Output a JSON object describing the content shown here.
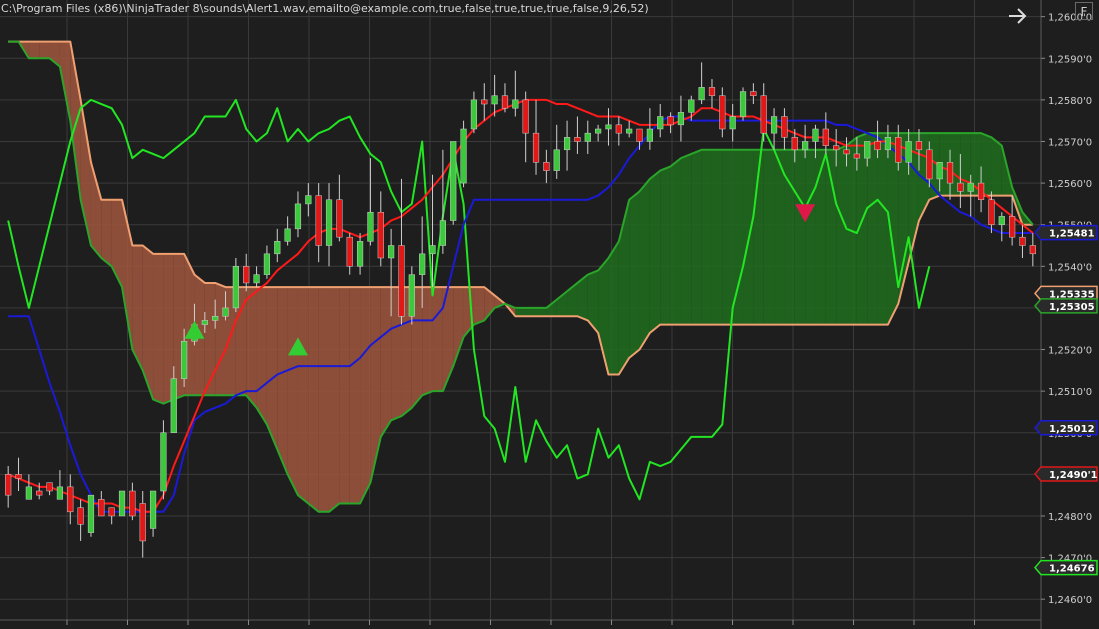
{
  "header": {
    "indicator_settings": "C:\\Program Files (x86)\\NinjaTrader 8\\sounds\\Alert1.wav,emailto@example.com,true,false,true,true,true,false,9,26,52)",
    "arrow_icon": "arrow-right-icon",
    "f_button_label": "F"
  },
  "colors": {
    "background": "#1e1e1e",
    "grid": "#3a3a3a",
    "up_candle": "#3cc83c",
    "down_candle": "#e01818",
    "tenkan": "#ff1a1a",
    "kijun": "#1a1ad8",
    "chikou": "#22e622",
    "span_a": "#f0a070",
    "span_b": "#2aa52a",
    "cloud_bear": "#a0573e",
    "cloud_bull": "#1f6e1f"
  },
  "chart_data": {
    "type": "candlestick",
    "y_axis": {
      "range": [
        1.2455,
        1.2604
      ],
      "ticks": [
        "1,2600'0",
        "1,2590'0",
        "1,2580'0",
        "1,2570'0",
        "1,2560'0",
        "1,2550'0",
        "1,2540'0",
        "1,2530'0",
        "1,2520'0",
        "1,2510'0",
        "1,2500'0",
        "1,2490'0",
        "1,2480'0",
        "1,2470'0",
        "1,2460'0"
      ],
      "tick_values": [
        1.26,
        1.259,
        1.258,
        1.257,
        1.256,
        1.255,
        1.254,
        1.253,
        1.252,
        1.251,
        1.25,
        1.249,
        1.248,
        1.247,
        1.246
      ]
    },
    "x_count": 100,
    "price_flags": [
      {
        "label": "1,25481",
        "value": 1.25481,
        "color": "#1a1ad8"
      },
      {
        "label": "1,25335",
        "value": 1.25335,
        "color": "#f0a070"
      },
      {
        "label": "1,25305",
        "value": 1.25305,
        "color": "#2aa52a"
      },
      {
        "label": "1,25012",
        "value": 1.25012,
        "color": "#1a1ad8"
      },
      {
        "label": "1,2490'1",
        "value": 1.24901,
        "color": "#e01818"
      },
      {
        "label": "1,24676",
        "value": 1.24676,
        "color": "#22e622"
      }
    ],
    "candles": [
      [
        1.249,
        1.2492,
        1.2485,
        1.2482
      ],
      [
        1.249,
        1.2494,
        1.2489,
        1.2486
      ],
      [
        1.2484,
        1.249,
        1.2487,
        1.2486
      ],
      [
        1.2486,
        1.2488,
        1.2485,
        1.2484
      ],
      [
        1.2488,
        1.2488,
        1.2486,
        1.2485
      ],
      [
        1.2484,
        1.2491,
        1.2487,
        1.2484
      ],
      [
        1.2487,
        1.249,
        1.2481,
        1.2478
      ],
      [
        1.2482,
        1.2484,
        1.2478,
        1.2474
      ],
      [
        1.2476,
        1.248,
        1.2485,
        1.2475
      ],
      [
        1.2484,
        1.2486,
        1.248,
        1.248
      ],
      [
        1.2482,
        1.2482,
        1.248,
        1.2478
      ],
      [
        1.248,
        1.2483,
        1.2486,
        1.248
      ],
      [
        1.2486,
        1.2488,
        1.248,
        1.2479
      ],
      [
        1.2483,
        1.2486,
        1.2474,
        1.247
      ],
      [
        1.2477,
        1.2484,
        1.2486,
        1.2475
      ],
      [
        1.2486,
        1.2503,
        1.25,
        1.2484
      ],
      [
        1.25,
        1.2516,
        1.2513,
        1.25
      ],
      [
        1.2513,
        1.2525,
        1.2522,
        1.2511
      ],
      [
        1.2522,
        1.2531,
        1.2526,
        1.2521
      ],
      [
        1.2526,
        1.2529,
        1.2527,
        1.2524
      ],
      [
        1.2527,
        1.2532,
        1.2528,
        1.2525
      ],
      [
        1.2528,
        1.2534,
        1.253,
        1.2527
      ],
      [
        1.253,
        1.2542,
        1.254,
        1.2529
      ],
      [
        1.254,
        1.2543,
        1.2536,
        1.2534
      ],
      [
        1.2536,
        1.254,
        1.2538,
        1.2535
      ],
      [
        1.2538,
        1.2545,
        1.2543,
        1.2537
      ],
      [
        1.2543,
        1.2549,
        1.2546,
        1.2541
      ],
      [
        1.2546,
        1.2552,
        1.2549,
        1.2545
      ],
      [
        1.2549,
        1.2558,
        1.2555,
        1.2547
      ],
      [
        1.2555,
        1.256,
        1.2557,
        1.2552
      ],
      [
        1.2557,
        1.256,
        1.2545,
        1.2541
      ],
      [
        1.2545,
        1.256,
        1.2556,
        1.254
      ],
      [
        1.2556,
        1.2562,
        1.2547,
        1.2546
      ],
      [
        1.2547,
        1.2548,
        1.254,
        1.2538
      ],
      [
        1.254,
        1.2548,
        1.2546,
        1.2538
      ],
      [
        1.2546,
        1.2566,
        1.2553,
        1.2545
      ],
      [
        1.2553,
        1.2558,
        1.2542,
        1.254
      ],
      [
        1.2542,
        1.2549,
        1.2545,
        1.2528
      ],
      [
        1.2545,
        1.2561,
        1.2528,
        1.2526
      ],
      [
        1.2528,
        1.254,
        1.2538,
        1.2526
      ],
      [
        1.2538,
        1.2552,
        1.2543,
        1.253
      ],
      [
        1.2543,
        1.2562,
        1.2545,
        1.2535
      ],
      [
        1.2545,
        1.2568,
        1.2551,
        1.2543
      ],
      [
        1.2551,
        1.2569,
        1.257,
        1.255
      ],
      [
        1.256,
        1.2575,
        1.2573,
        1.2559
      ],
      [
        1.2573,
        1.2582,
        1.258,
        1.2572
      ],
      [
        1.258,
        1.2584,
        1.2579,
        1.2575
      ],
      [
        1.2579,
        1.2586,
        1.2581,
        1.2576
      ],
      [
        1.2581,
        1.2584,
        1.2578,
        1.2577
      ],
      [
        1.2578,
        1.2587,
        1.258,
        1.2576
      ],
      [
        1.258,
        1.2582,
        1.2572,
        1.2565
      ],
      [
        1.2572,
        1.258,
        1.2565,
        1.2562
      ],
      [
        1.2565,
        1.2568,
        1.2563,
        1.256
      ],
      [
        1.2563,
        1.2574,
        1.2568,
        1.2561
      ],
      [
        1.2568,
        1.2575,
        1.2571,
        1.2563
      ],
      [
        1.2571,
        1.2576,
        1.257,
        1.2567
      ],
      [
        1.257,
        1.2575,
        1.2572,
        1.2567
      ],
      [
        1.2572,
        1.2574,
        1.2573,
        1.257
      ],
      [
        1.2573,
        1.2578,
        1.2574,
        1.2569
      ],
      [
        1.2574,
        1.2576,
        1.2572,
        1.2569
      ],
      [
        1.2572,
        1.2575,
        1.2573,
        1.2571
      ],
      [
        1.2573,
        1.2573,
        1.257,
        1.2568
      ],
      [
        1.257,
        1.2578,
        1.2573,
        1.2568
      ],
      [
        1.2573,
        1.2579,
        1.2576,
        1.2571
      ],
      [
        1.2576,
        1.2577,
        1.2574,
        1.2572
      ],
      [
        1.2574,
        1.2581,
        1.2577,
        1.257
      ],
      [
        1.2577,
        1.2581,
        1.258,
        1.2575
      ],
      [
        1.258,
        1.2589,
        1.2583,
        1.2579
      ],
      [
        1.2583,
        1.2585,
        1.2581,
        1.2578
      ],
      [
        1.2581,
        1.2583,
        1.2573,
        1.2571
      ],
      [
        1.2573,
        1.2579,
        1.2576,
        1.257
      ],
      [
        1.2576,
        1.2583,
        1.2582,
        1.2575
      ],
      [
        1.2582,
        1.2584,
        1.2581,
        1.2579
      ],
      [
        1.2581,
        1.2584,
        1.2572,
        1.257
      ],
      [
        1.2572,
        1.2578,
        1.2576,
        1.2568
      ],
      [
        1.2576,
        1.2578,
        1.2571,
        1.2568
      ],
      [
        1.2571,
        1.2573,
        1.2568,
        1.2565
      ],
      [
        1.2568,
        1.2574,
        1.257,
        1.2566
      ],
      [
        1.257,
        1.2574,
        1.2573,
        1.2566
      ],
      [
        1.2573,
        1.2577,
        1.2569,
        1.2567
      ],
      [
        1.2569,
        1.2573,
        1.2568,
        1.2564
      ],
      [
        1.2568,
        1.2571,
        1.2567,
        1.2564
      ],
      [
        1.2567,
        1.2571,
        1.2566,
        1.2563
      ],
      [
        1.2566,
        1.257,
        1.257,
        1.2564
      ],
      [
        1.257,
        1.2575,
        1.2568,
        1.2566
      ],
      [
        1.2568,
        1.2574,
        1.2571,
        1.2566
      ],
      [
        1.2571,
        1.2574,
        1.2565,
        1.2563
      ],
      [
        1.2565,
        1.2573,
        1.257,
        1.2562
      ],
      [
        1.257,
        1.2573,
        1.2568,
        1.2563
      ],
      [
        1.2568,
        1.257,
        1.2561,
        1.2559
      ],
      [
        1.2561,
        1.2563,
        1.2565,
        1.2558
      ],
      [
        1.2565,
        1.2568,
        1.256,
        1.2556
      ],
      [
        1.256,
        1.2567,
        1.2558,
        1.2554
      ],
      [
        1.2558,
        1.2562,
        1.256,
        1.2552
      ],
      [
        1.256,
        1.2564,
        1.2556,
        1.2553
      ],
      [
        1.2556,
        1.2558,
        1.255,
        1.2548
      ],
      [
        1.255,
        1.2553,
        1.2552,
        1.2546
      ],
      [
        1.2552,
        1.2557,
        1.2547,
        1.2545
      ],
      [
        1.2547,
        1.255,
        1.2545,
        1.2542
      ],
      [
        1.2545,
        1.2548,
        1.2543,
        1.254
      ]
    ],
    "tenkan": [
      1.249,
      1.2489,
      1.2488,
      1.2487,
      1.2487,
      1.2486,
      1.2485,
      1.2484,
      1.2483,
      1.2483,
      1.2483,
      1.2482,
      1.2482,
      1.2481,
      1.2481,
      1.2485,
      1.2492,
      1.2498,
      1.2504,
      1.251,
      1.2515,
      1.252,
      1.2527,
      1.2532,
      1.2534,
      1.2536,
      1.2539,
      1.2541,
      1.2543,
      1.2546,
      1.2548,
      1.2549,
      1.2549,
      1.2548,
      1.2547,
      1.2548,
      1.2549,
      1.2551,
      1.2552,
      1.2554,
      1.2556,
      1.2559,
      1.2562,
      1.2566,
      1.257,
      1.2573,
      1.2575,
      1.2577,
      1.2578,
      1.2579,
      1.258,
      1.258,
      1.258,
      1.2579,
      1.2579,
      1.2578,
      1.2577,
      1.2576,
      1.2576,
      1.2576,
      1.2575,
      1.2574,
      1.2574,
      1.2574,
      1.2574,
      1.2575,
      1.2576,
      1.2578,
      1.2578,
      1.2577,
      1.2576,
      1.2576,
      1.2576,
      1.2575,
      1.2574,
      1.2573,
      1.2572,
      1.2571,
      1.2571,
      1.2571,
      1.257,
      1.2569,
      1.2569,
      1.2569,
      1.257,
      1.257,
      1.2569,
      1.2568,
      1.2567,
      1.2566,
      1.2564,
      1.2563,
      1.2561,
      1.256,
      1.2558,
      1.2556,
      1.2554,
      1.2552,
      1.255,
      1.2548
    ],
    "kijun": [
      1.2528,
      1.2528,
      1.2528,
      1.252,
      1.2512,
      1.2505,
      1.2497,
      1.249,
      1.2485,
      1.2481,
      1.2481,
      1.2481,
      1.2481,
      1.2481,
      1.2481,
      1.2481,
      1.2485,
      1.2495,
      1.2503,
      1.2505,
      1.2506,
      1.2507,
      1.2509,
      1.251,
      1.251,
      1.2512,
      1.2514,
      1.2515,
      1.2516,
      1.2516,
      1.2516,
      1.2516,
      1.2516,
      1.2516,
      1.2518,
      1.2521,
      1.2523,
      1.2525,
      1.2526,
      1.2527,
      1.2527,
      1.2527,
      1.253,
      1.254,
      1.255,
      1.2556,
      1.2556,
      1.2556,
      1.2556,
      1.2556,
      1.2556,
      1.2556,
      1.2556,
      1.2556,
      1.2556,
      1.2556,
      1.2556,
      1.2557,
      1.2559,
      1.2562,
      1.2566,
      1.2569,
      1.2572,
      1.2575,
      1.2576,
      1.2576,
      1.2575,
      1.2575,
      1.2575,
      1.2575,
      1.2575,
      1.2575,
      1.2575,
      1.2575,
      1.2575,
      1.2575,
      1.2575,
      1.2575,
      1.2575,
      1.2575,
      1.2574,
      1.2574,
      1.2573,
      1.2572,
      1.2571,
      1.2569,
      1.2567,
      1.2565,
      1.2562,
      1.256,
      1.2557,
      1.2555,
      1.2553,
      1.2552,
      1.255,
      1.2549,
      1.2548,
      1.2548,
      1.2548,
      1.2548
    ],
    "chikou": [
      1.2551,
      1.254,
      1.253,
      1.254,
      1.255,
      1.256,
      1.257,
      1.2578,
      1.258,
      1.2579,
      1.2578,
      1.2574,
      1.2566,
      1.2568,
      1.2567,
      1.2566,
      1.2568,
      1.257,
      1.2572,
      1.2576,
      1.2576,
      1.2576,
      1.258,
      1.2573,
      1.257,
      1.2572,
      1.2578,
      1.257,
      1.2573,
      1.257,
      1.2572,
      1.2573,
      1.2575,
      1.2576,
      1.2571,
      1.2567,
      1.2565,
      1.2558,
      1.2553,
      1.2555,
      1.257,
      1.2533,
      1.2552,
      1.2568,
      1.2555,
      1.252,
      1.2504,
      1.2501,
      1.2493,
      1.2511,
      1.2493,
      1.2503,
      1.2498,
      1.2494,
      1.2497,
      1.2489,
      1.249,
      1.2501,
      1.2494,
      1.2497,
      1.2489,
      1.2484,
      1.2493,
      1.2492,
      1.2493,
      1.2496,
      1.2499,
      1.2499,
      1.2499,
      1.2502,
      1.253,
      1.254,
      1.2552,
      1.2573,
      1.2568,
      1.2562,
      1.2558,
      1.2554,
      1.2559,
      1.2567,
      1.2555,
      1.2549,
      1.2548,
      1.2554,
      1.2556,
      1.2553,
      1.2535,
      1.2547,
      1.253,
      1.254
    ],
    "span_a": [
      1.2594,
      1.2594,
      1.2594,
      1.2594,
      1.2594,
      1.2594,
      1.2594,
      1.258,
      1.2565,
      1.2556,
      1.2556,
      1.2556,
      1.2545,
      1.2545,
      1.2543,
      1.2543,
      1.2543,
      1.2543,
      1.2538,
      1.2536,
      1.2536,
      1.2535,
      1.2535,
      1.2535,
      1.2535,
      1.2535,
      1.2535,
      1.2535,
      1.2535,
      1.2535,
      1.2535,
      1.2535,
      1.2535,
      1.2535,
      1.2535,
      1.2535,
      1.2535,
      1.2535,
      1.2535,
      1.2535,
      1.2535,
      1.2535,
      1.2535,
      1.2535,
      1.2535,
      1.2535,
      1.2535,
      1.2533,
      1.2531,
      1.2528,
      1.2528,
      1.2528,
      1.2528,
      1.2528,
      1.2528,
      1.2528,
      1.2527,
      1.2524,
      1.2514,
      1.2514,
      1.2518,
      1.252,
      1.2524,
      1.2526,
      1.2526,
      1.2526,
      1.2526,
      1.2526,
      1.2526,
      1.2526,
      1.2526,
      1.2526,
      1.2526,
      1.2526,
      1.2526,
      1.2526,
      1.2526,
      1.2526,
      1.2526,
      1.2526,
      1.2526,
      1.2526,
      1.2526,
      1.2526,
      1.2526,
      1.2526,
      1.2531,
      1.2541,
      1.2551,
      1.2556,
      1.2557,
      1.2557,
      1.2557,
      1.2557,
      1.2557,
      1.2557,
      1.2557,
      1.2557,
      1.255,
      1.255
    ],
    "span_b": [
      1.2594,
      1.2594,
      1.259,
      1.259,
      1.259,
      1.2588,
      1.2575,
      1.2556,
      1.2545,
      1.2542,
      1.254,
      1.2535,
      1.252,
      1.2515,
      1.2508,
      1.2507,
      1.2508,
      1.2509,
      1.2509,
      1.2509,
      1.2509,
      1.2509,
      1.2509,
      1.2509,
      1.2506,
      1.2502,
      1.2496,
      1.249,
      1.2485,
      1.2483,
      1.2481,
      1.2481,
      1.2483,
      1.2483,
      1.2483,
      1.2488,
      1.2499,
      1.2503,
      1.2504,
      1.2506,
      1.2509,
      1.251,
      1.251,
      1.2516,
      1.2523,
      1.2526,
      1.2527,
      1.253,
      1.2531,
      1.253,
      1.253,
      1.253,
      1.253,
      1.2532,
      1.2534,
      1.2536,
      1.2538,
      1.2539,
      1.2542,
      1.2546,
      1.2556,
      1.2558,
      1.2561,
      1.2563,
      1.2564,
      1.2566,
      1.2567,
      1.2568,
      1.2568,
      1.2568,
      1.2568,
      1.2568,
      1.2568,
      1.2568,
      1.2568,
      1.2568,
      1.2568,
      1.2568,
      1.2568,
      1.2568,
      1.2568,
      1.2569,
      1.2571,
      1.2572,
      1.2572,
      1.2572,
      1.2572,
      1.2572,
      1.2572,
      1.2572,
      1.2572,
      1.2572,
      1.2572,
      1.2572,
      1.2572,
      1.2571,
      1.2569,
      1.2559,
      1.2553,
      1.255
    ],
    "signals": [
      {
        "type": "buy",
        "index": 18,
        "price": 1.2525
      },
      {
        "type": "buy",
        "index": 28,
        "price": 1.2521
      },
      {
        "type": "sell",
        "index": 77,
        "price": 1.2553
      }
    ]
  }
}
